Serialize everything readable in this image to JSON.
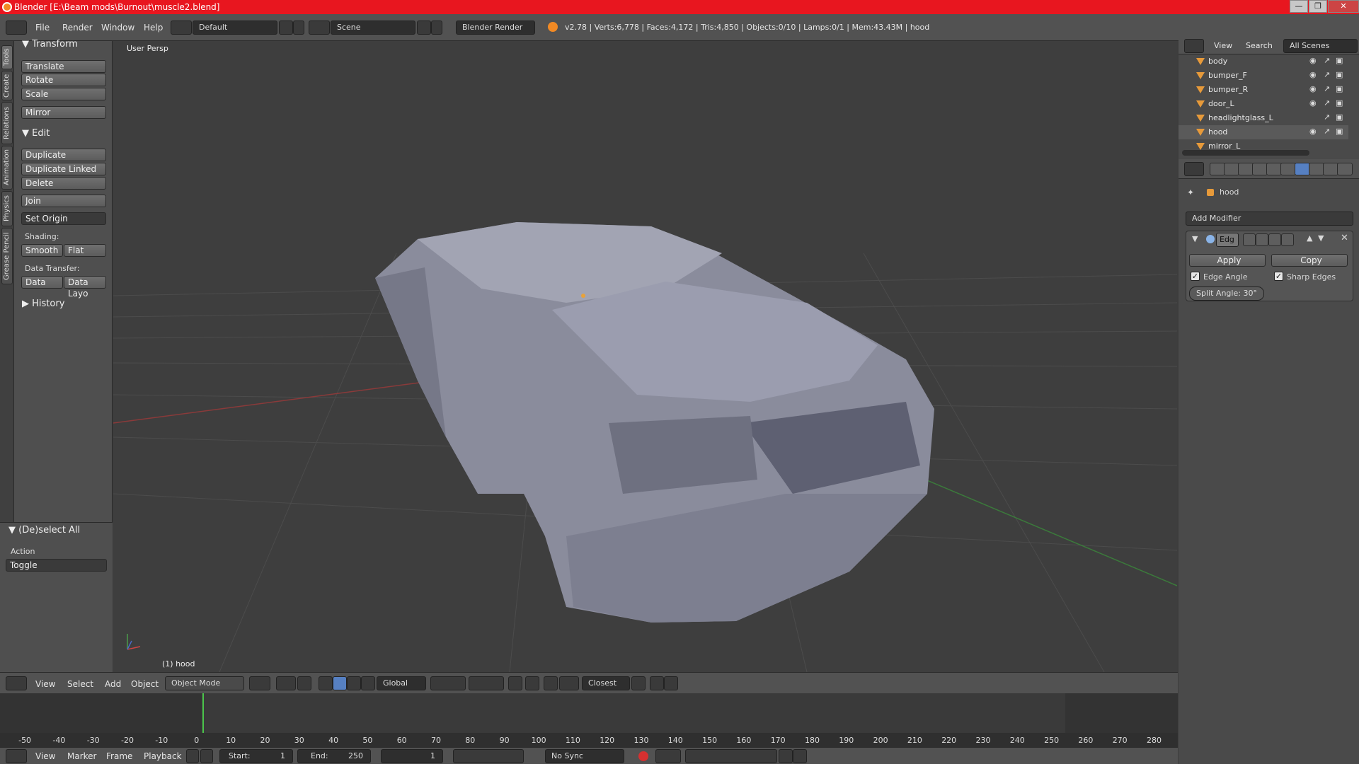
{
  "window": {
    "title": "Blender [E:\\Beam mods\\Burnout\\muscle2.blend]"
  },
  "menu": {
    "file": "File",
    "render": "Render",
    "window": "Window",
    "help": "Help"
  },
  "screen_layout": "Default",
  "scene": "Scene",
  "render_engine": "Blender Render",
  "stats": "v2.78 | Verts:6,778 | Faces:4,172 | Tris:4,850 | Objects:0/10 | Lamps:0/1 | Mem:43.43M | hood",
  "left_tabs": [
    "Tools",
    "Create",
    "Relations",
    "Animation",
    "Physics",
    "Grease Pencil"
  ],
  "tools": {
    "transform_header": "Transform",
    "translate": "Translate",
    "rotate": "Rotate",
    "scale": "Scale",
    "mirror": "Mirror",
    "edit_header": "Edit",
    "duplicate": "Duplicate",
    "duplicate_linked": "Duplicate Linked",
    "delete": "Delete",
    "join": "Join",
    "set_origin": "Set Origin",
    "shading_label": "Shading:",
    "smooth": "Smooth",
    "flat": "Flat",
    "data_transfer_label": "Data Transfer:",
    "data": "Data",
    "data_layout": "Data Layo",
    "history_header": "History"
  },
  "operator": {
    "header": "(De)select All",
    "action_label": "Action",
    "action_value": "Toggle"
  },
  "viewport": {
    "perspective_label": "User Persp",
    "object_label": "(1) hood"
  },
  "view3d_header": {
    "view": "View",
    "select": "Select",
    "add": "Add",
    "object": "Object",
    "mode": "Object Mode",
    "orientation": "Global",
    "snap_target": "Closest"
  },
  "timeline": {
    "ticks": [
      "-50",
      "-40",
      "-30",
      "-20",
      "-10",
      "0",
      "10",
      "20",
      "30",
      "40",
      "50",
      "60",
      "70",
      "80",
      "90",
      "100",
      "110",
      "120",
      "130",
      "140",
      "150",
      "160",
      "170",
      "180",
      "190",
      "200",
      "210",
      "220",
      "230",
      "240",
      "250",
      "260",
      "270",
      "280"
    ],
    "current_frame": 0,
    "view": "View",
    "marker": "Marker",
    "frame": "Frame",
    "playback": "Playback",
    "start_label": "Start:",
    "start_value": "1",
    "end_label": "End:",
    "end_value": "250",
    "frame_value": "1",
    "sync": "No Sync"
  },
  "outliner": {
    "view": "View",
    "search": "Search",
    "scenes": "All Scenes",
    "items": [
      "body",
      "bumper_F",
      "bumper_R",
      "door_L",
      "headlightglass_L",
      "hood",
      "mirror_L"
    ]
  },
  "properties": {
    "context_object": "hood",
    "add_modifier": "Add Modifier",
    "modifier_name": "Edg",
    "apply": "Apply",
    "copy": "Copy",
    "edge_angle": "Edge Angle",
    "sharp_edges": "Sharp Edges",
    "split_angle": "Split Angle: 30°"
  },
  "colors": {
    "title_bar": "#e8161f",
    "active_modifier_tab": "#5680c2",
    "playhead": "#4ac44a"
  }
}
